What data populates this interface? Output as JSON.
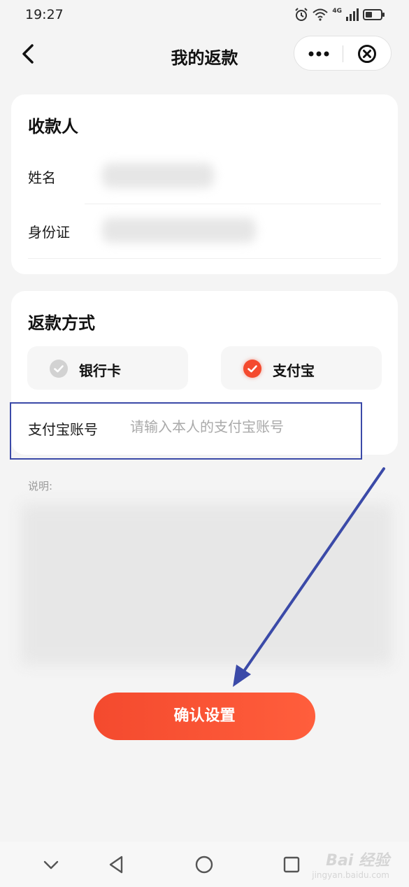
{
  "status_bar": {
    "time": "19:27",
    "network": "4G"
  },
  "nav": {
    "title": "我的返款"
  },
  "payee": {
    "title": "收款人",
    "name_label": "姓名",
    "id_label": "身份证"
  },
  "refund_method": {
    "title": "返款方式",
    "options": [
      {
        "label": "银行卡",
        "selected": false
      },
      {
        "label": "支付宝",
        "selected": true
      }
    ],
    "account_label": "支付宝账号",
    "account_value": "",
    "account_placeholder": "请输入本人的支付宝账号"
  },
  "description": {
    "label": "说明:"
  },
  "confirm": {
    "label": "确认设置"
  },
  "watermark": {
    "main": "Bai 经验",
    "sub": "jingyan.baidu.com"
  },
  "colors": {
    "accent": "#f44a2e",
    "highlight_border": "#3b4aa8",
    "background": "#f4f4f4"
  }
}
